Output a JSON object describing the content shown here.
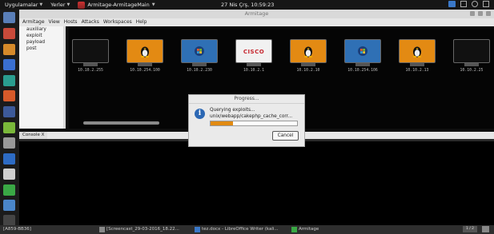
{
  "topbar": {
    "applications": "Uygulamalar",
    "places": "Yerler",
    "active_app": "Armitage-ArmitageMain",
    "clock": "27 Nis Çrş, 10:59:23"
  },
  "window": {
    "title": "Armitage",
    "menu": [
      "Armitage",
      "View",
      "Hosts",
      "Attacks",
      "Workspaces",
      "Help"
    ]
  },
  "modules": {
    "items": [
      "auxiliary",
      "exploit",
      "payload",
      "post"
    ]
  },
  "hosts": [
    {
      "label": "10.10.2.255",
      "screen": "black"
    },
    {
      "label": "10.10.254.100",
      "screen": "linux"
    },
    {
      "label": "10.10.2.230",
      "screen": "windows"
    },
    {
      "label": "10.10.2.1",
      "screen": "cisco"
    },
    {
      "label": "10.10.2.10",
      "screen": "linux"
    },
    {
      "label": "10.10.254.106",
      "screen": "windows"
    },
    {
      "label": "10.10.2.13",
      "screen": "linux"
    },
    {
      "label": "10.10.2.25",
      "screen": "black"
    }
  ],
  "cisco_text": "CISCO",
  "tab": {
    "label": "Console",
    "close": "X"
  },
  "dialog": {
    "title": "Progress...",
    "line1": "Querying exploits...",
    "line2": "unix/webapp/cakephp_cache_corr...",
    "progress": 0.26,
    "cancel": "Cancel",
    "icon": "info-icon"
  },
  "taskbar": {
    "items": [
      "[A859-BB36]",
      "[Screencast_29-03-2016_18.22...",
      "tez.docx - LibreOffice Writer (kali...",
      "Armitage"
    ],
    "pager": "1 / 2"
  },
  "colors": {
    "orange": "#e38a13",
    "blue": "#2f70b5",
    "cisco_red": "#c6262e",
    "info_blue": "#2c68b4"
  }
}
